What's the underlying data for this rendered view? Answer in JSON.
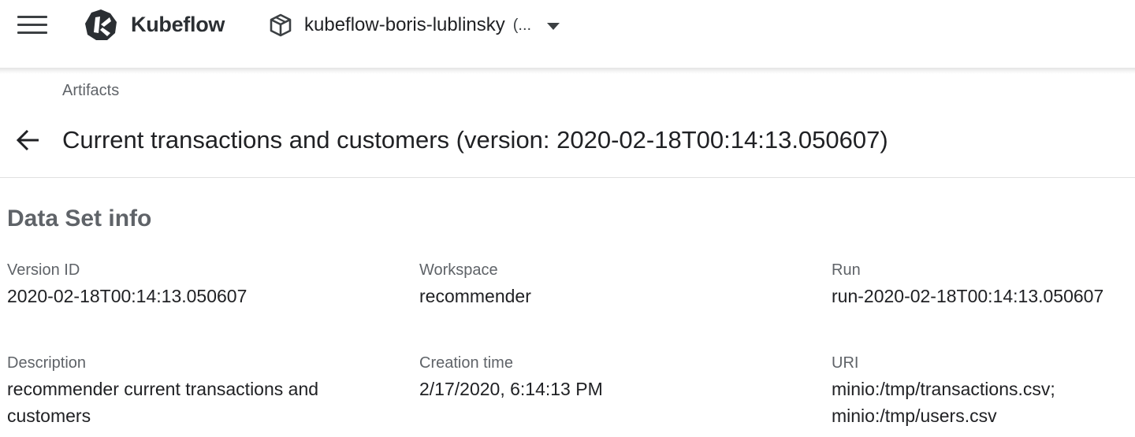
{
  "header": {
    "brand": "Kubeflow",
    "namespace": "kubeflow-boris-lublinsky",
    "namespace_suffix": "(..."
  },
  "breadcrumb": "Artifacts",
  "page_title": "Current transactions and customers (version: 2020-02-18T00:14:13.050607)",
  "section_title": "Data Set info",
  "fields": {
    "version_id": {
      "label": "Version ID",
      "value": "2020-02-18T00:14:13.050607"
    },
    "workspace": {
      "label": "Workspace",
      "value": "recommender"
    },
    "run": {
      "label": "Run",
      "value": "run-2020-02-18T00:14:13.050607"
    },
    "description": {
      "label": "Description",
      "value_line1": "recommender current transactions and",
      "value_line2": "customers"
    },
    "creation_time": {
      "label": "Creation time",
      "value": "2/17/2020, 6:14:13 PM"
    },
    "uri": {
      "label": "URI",
      "value_line1": "minio:/tmp/transactions.csv;",
      "value_line2": "minio:/tmp/users.csv"
    }
  },
  "icons": {
    "menu": "menu-icon",
    "logo": "kubeflow-logo-icon",
    "namespace": "cube-icon",
    "caret": "caret-down-icon",
    "back": "arrow-back-icon"
  },
  "colors": {
    "text_primary": "#202124",
    "text_secondary": "#5f6368",
    "icon": "#3c4043"
  }
}
